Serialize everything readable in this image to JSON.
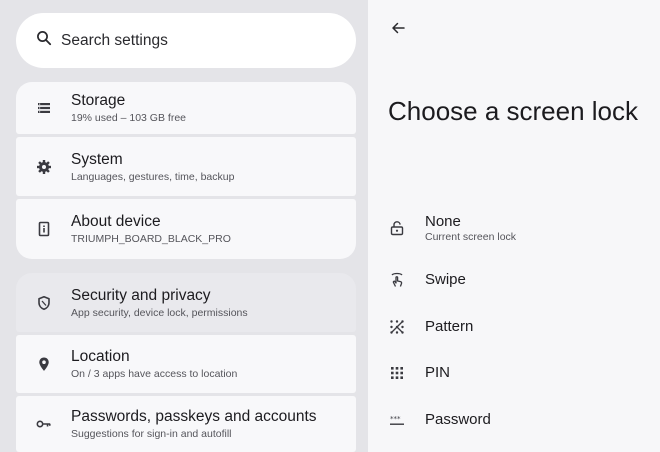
{
  "search": {
    "placeholder": "Search settings",
    "icon": "search-icon"
  },
  "settings_list": [
    {
      "id": "storage",
      "icon": "storage-icon",
      "title": "Storage",
      "subtitle": "19% used – 103 GB free"
    },
    {
      "id": "system",
      "icon": "gear-icon",
      "title": "System",
      "subtitle": "Languages, gestures, time, backup"
    },
    {
      "id": "about",
      "icon": "device-info-icon",
      "title": "About device",
      "subtitle": "TRIUMPH_BOARD_BLACK_PRO"
    },
    {
      "id": "security",
      "icon": "shield-icon",
      "title": "Security and privacy",
      "subtitle": "App security, device lock, permissions"
    },
    {
      "id": "location",
      "icon": "location-pin-icon",
      "title": "Location",
      "subtitle": "On / 3 apps have access to location"
    },
    {
      "id": "passwords",
      "icon": "key-icon",
      "title": "Passwords, passkeys and accounts",
      "subtitle": "Suggestions for sign-in and autofill"
    }
  ],
  "detail": {
    "back_icon": "back-arrow-icon",
    "title": "Choose a screen lock",
    "options": [
      {
        "id": "none",
        "icon": "unlocked-padlock-icon",
        "label": "None",
        "subtitle": "Current screen lock"
      },
      {
        "id": "swipe",
        "icon": "swipe-gesture-icon",
        "label": "Swipe"
      },
      {
        "id": "pattern",
        "icon": "pattern-icon",
        "label": "Pattern"
      },
      {
        "id": "pin",
        "icon": "pin-dots-icon",
        "label": "PIN"
      },
      {
        "id": "password",
        "icon": "password-icon",
        "label": "Password"
      }
    ]
  }
}
